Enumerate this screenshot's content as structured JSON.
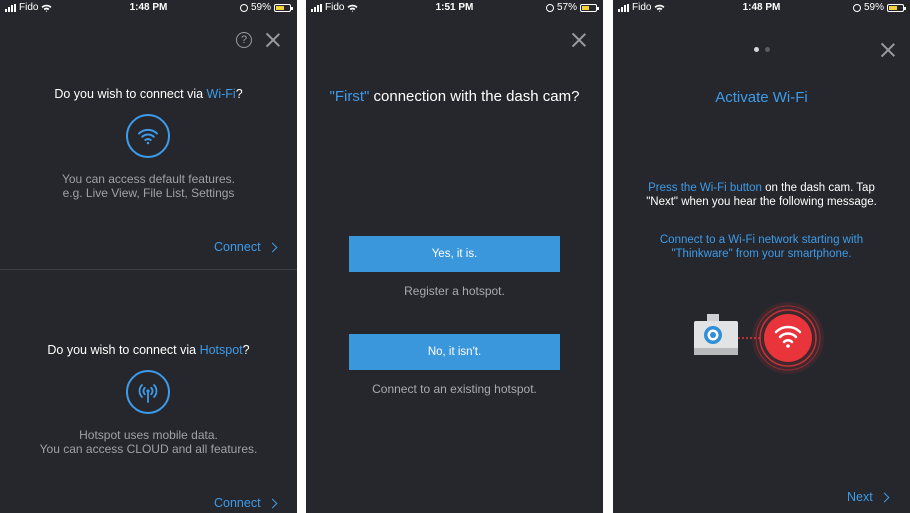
{
  "screen1": {
    "status": {
      "carrier": "Fido",
      "time": "1:48 PM",
      "battery": "59%"
    },
    "wifi_question_prefix": "Do you wish to connect via ",
    "wifi_question_highlight": "Wi-Fi",
    "wifi_question_suffix": "?",
    "wifi_desc_line1": "You can access default features.",
    "wifi_desc_line2": "e.g. Live View, File List, Settings",
    "wifi_connect_label": "Connect",
    "hotspot_question_prefix": "Do you wish to connect via ",
    "hotspot_question_highlight": "Hotspot",
    "hotspot_question_suffix": "?",
    "hotspot_desc_line1": "Hotspot uses mobile data.",
    "hotspot_desc_line2": "You can access CLOUD and all features.",
    "hotspot_connect_label": "Connect",
    "help_label": "?"
  },
  "screen2": {
    "status": {
      "carrier": "Fido",
      "time": "1:51 PM",
      "battery": "57%"
    },
    "title_highlight": "\"First\"",
    "title_rest": " connection with the dash cam?",
    "yes_button": "Yes, it is.",
    "yes_sub": "Register a hotspot.",
    "no_button": "No, it isn't.",
    "no_sub": "Connect to an existing hotspot."
  },
  "screen3": {
    "status": {
      "carrier": "Fido",
      "time": "1:48 PM",
      "battery": "59%"
    },
    "title": "Activate Wi-Fi",
    "para1_highlight": "Press the Wi-Fi button",
    "para1_rest": " on the dash cam. Tap",
    "para1_line2": "\"Next\" when you hear the following message.",
    "para2_line1": "Connect to a Wi-Fi network starting with",
    "para2_line2": "\"Thinkware\" from your smartphone.",
    "next_label": "Next"
  },
  "colors": {
    "background": "#26272c",
    "accent": "#3d9be9",
    "button": "#3a97dc",
    "wifi_red": "#e8343a"
  },
  "icons": [
    "wifi-icon",
    "hotspot-antenna-icon",
    "close-icon",
    "help-icon",
    "chevron-right-icon",
    "dashcam-icon"
  ]
}
